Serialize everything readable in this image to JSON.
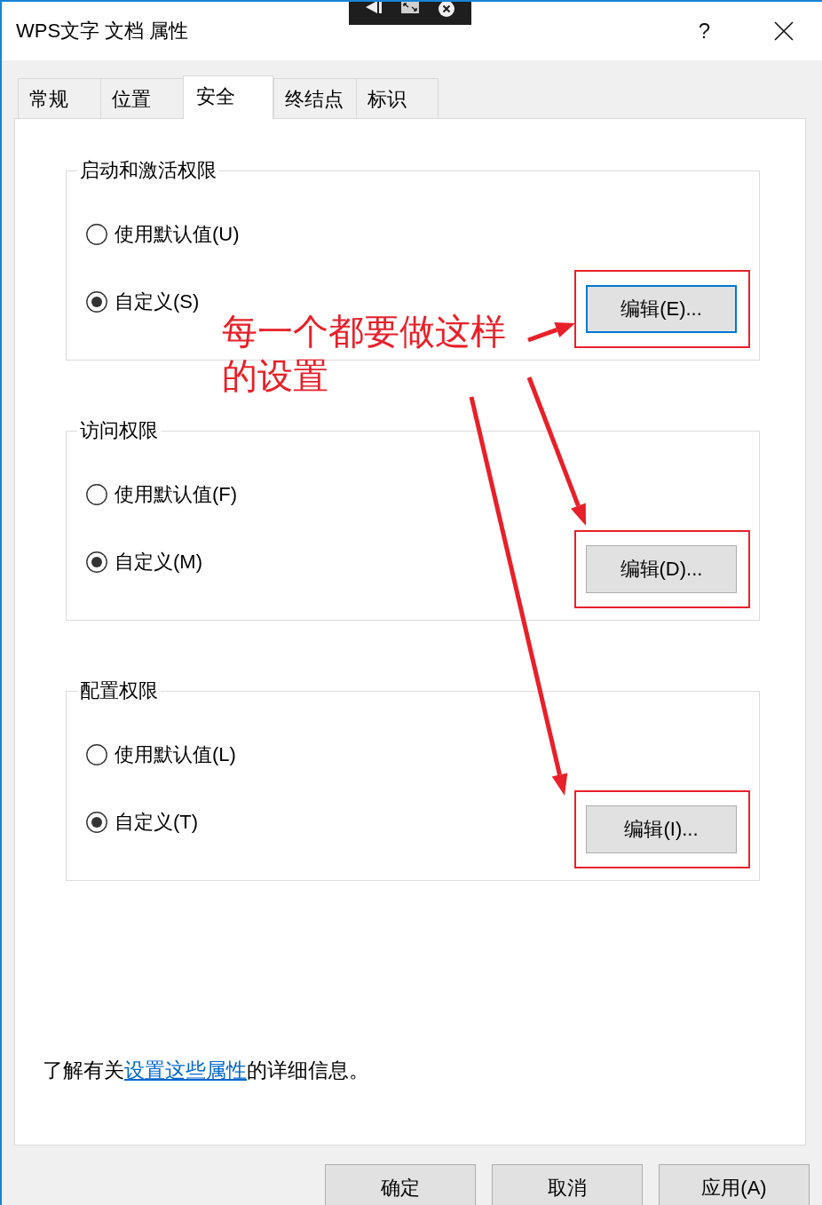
{
  "window": {
    "title": "WPS文字 文档 属性",
    "help": "?"
  },
  "tabs": [
    {
      "label": "常规",
      "selected": false
    },
    {
      "label": "位置",
      "selected": false
    },
    {
      "label": "安全",
      "selected": true
    },
    {
      "label": "终结点",
      "selected": false
    },
    {
      "label": "标识",
      "selected": false
    }
  ],
  "groups": [
    {
      "title": "启动和激活权限",
      "options": [
        {
          "label": "使用默认值(U)",
          "selected": false
        },
        {
          "label": "自定义(S)",
          "selected": true
        }
      ],
      "button": {
        "label": "编辑(E)...",
        "focused": true,
        "highlighted": true
      }
    },
    {
      "title": "访问权限",
      "options": [
        {
          "label": "使用默认值(F)",
          "selected": false
        },
        {
          "label": "自定义(M)",
          "selected": true
        }
      ],
      "button": {
        "label": "编辑(D)...",
        "focused": false,
        "highlighted": true
      }
    },
    {
      "title": "配置权限",
      "options": [
        {
          "label": "使用默认值(L)",
          "selected": false
        },
        {
          "label": "自定义(T)",
          "selected": true
        }
      ],
      "button": {
        "label": "编辑(I)...",
        "focused": false,
        "highlighted": true
      }
    }
  ],
  "annotation": {
    "text": "每一个都要做这样的设置"
  },
  "info": {
    "before": "了解有关",
    "link": "设置这些属性",
    "after": "的详细信息。"
  },
  "buttons": [
    {
      "label": "确定"
    },
    {
      "label": "取消"
    },
    {
      "label": "应用(A)"
    }
  ]
}
